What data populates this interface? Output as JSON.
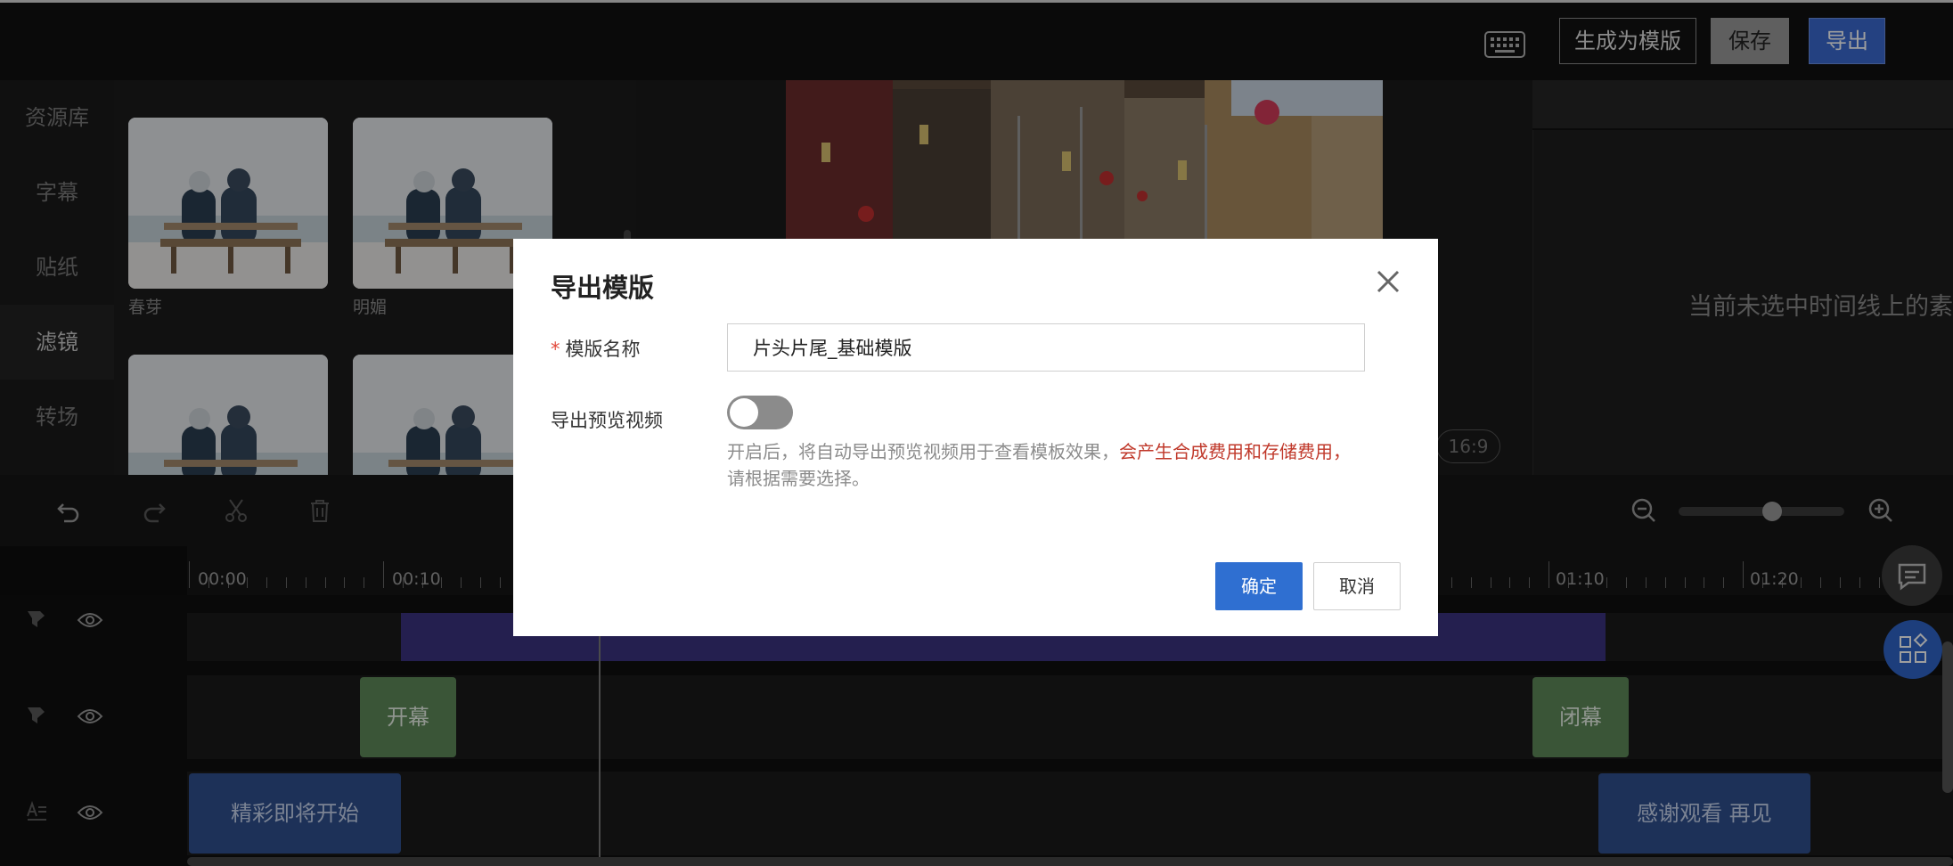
{
  "toolbar": {
    "keyboard_icon": "keyboard-icon",
    "generate_template_label": "生成为模版",
    "save_label": "保存",
    "export_label": "导出"
  },
  "sidebar": {
    "items": [
      {
        "label": "资源库",
        "active": false
      },
      {
        "label": "字幕",
        "active": false
      },
      {
        "label": "贴纸",
        "active": false
      },
      {
        "label": "滤镜",
        "active": true
      },
      {
        "label": "转场",
        "active": false
      }
    ]
  },
  "resources": {
    "items": [
      {
        "label": "春芽"
      },
      {
        "label": "明媚"
      }
    ]
  },
  "preview": {
    "aspect_ratio": "16:9"
  },
  "properties": {
    "empty_tip": "当前未选中时间线上的素"
  },
  "timeline": {
    "ruler_labels": [
      "00:00",
      "00:10",
      "01:10",
      "01:20"
    ],
    "sticker_clips": [
      "开幕",
      "闭幕"
    ],
    "text_clips": [
      "精彩即将开始",
      "感谢观看 再见"
    ],
    "zoom_level": 0.5
  },
  "modal": {
    "title": "导出模版",
    "name_label": "模版名称",
    "name_value": "片头片尾_基础模版",
    "preview_label": "导出预览视频",
    "preview_enabled": false,
    "hint_normal": "开启后，将自动导出预览视频用于查看模板效果，",
    "hint_warn": "会产生合成费用和存储费用，",
    "hint_tail": "请根据需要选择。",
    "ok_label": "确定",
    "cancel_label": "取消"
  },
  "colors": {
    "accent": "#2f6fd1",
    "warning": "#c0392b",
    "filter_clip": "#3a3380",
    "sticker_clip": "#5e8a5a",
    "text_clip": "#2f4f8f"
  }
}
